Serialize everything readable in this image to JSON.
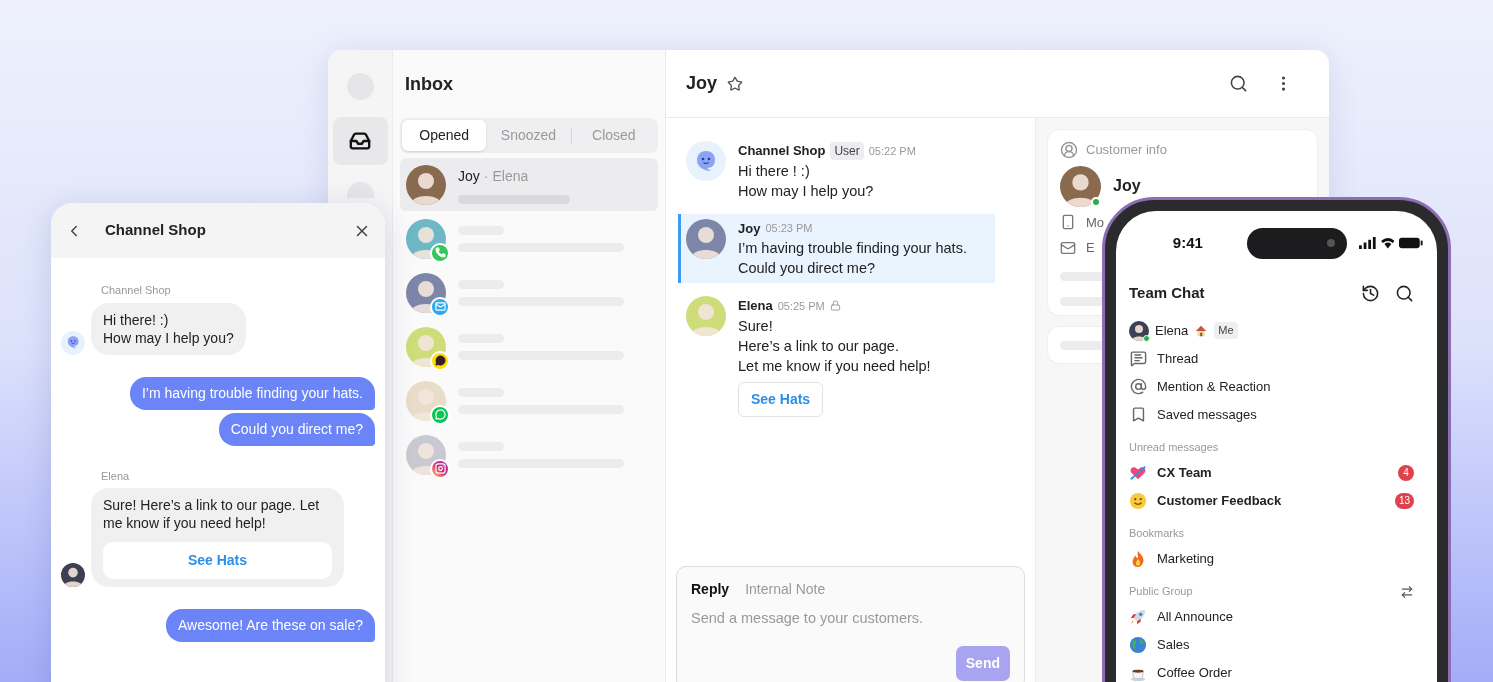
{
  "desktop": {
    "rail": [
      {
        "kind": "placeholder",
        "selected": false
      },
      {
        "kind": "inbox",
        "selected": true
      },
      {
        "kind": "placeholder",
        "selected": false
      }
    ],
    "inbox": {
      "title": "Inbox",
      "tabs": [
        {
          "label": "Opened",
          "selected": true
        },
        {
          "label": "Snoozed",
          "selected": false
        },
        {
          "label": "Closed",
          "selected": false
        }
      ],
      "conversations": [
        {
          "kind": "named",
          "name": "Joy",
          "separator": "·",
          "assignee": "Elena",
          "selected": true
        },
        {
          "kind": "phone",
          "selected": false
        },
        {
          "kind": "email",
          "selected": false
        },
        {
          "kind": "chat",
          "selected": false
        },
        {
          "kind": "line",
          "selected": false
        },
        {
          "kind": "instagram",
          "selected": false
        }
      ]
    },
    "chat": {
      "title": "Joy",
      "messages": [
        {
          "kind": "bot",
          "sender": "Channel Shop",
          "tag": "User",
          "time": "05:22 PM",
          "lines": [
            "Hi there ! :)",
            "How may I help you?"
          ],
          "highlighted": false,
          "locked": false
        },
        {
          "kind": "person",
          "sender": "Joy",
          "time": "05:23 PM",
          "lines": [
            "I’m having trouble finding your hats.",
            "Could you direct me?"
          ],
          "highlighted": true,
          "locked": false
        },
        {
          "kind": "person",
          "sender": "Elena",
          "time": "05:25 PM",
          "lines": [
            "Sure!",
            "Here’s a link to our page.",
            "Let me know if you need help!"
          ],
          "button": "See Hats",
          "highlighted": false,
          "locked": true
        }
      ],
      "composer": {
        "tabs": [
          {
            "label": "Reply",
            "selected": true
          },
          {
            "label": "Internal Note",
            "selected": false
          }
        ],
        "placeholder": "Send a message to your customers.",
        "send": {
          "label": "Send",
          "disabled": true
        }
      }
    },
    "customer": {
      "title": "Customer info",
      "name": "Joy",
      "online": true,
      "fields": [
        {
          "kind": "phone",
          "label": "Mo"
        },
        {
          "kind": "email",
          "label": "E"
        }
      ]
    }
  },
  "widget": {
    "title": "Channel Shop",
    "messages": [
      {
        "kind": "bot",
        "sender": "Channel Shop",
        "lines": [
          "Hi there! :)",
          "How may I help you?"
        ]
      },
      {
        "kind": "outgoing",
        "lines": [
          "I’m having trouble finding your hats."
        ]
      },
      {
        "kind": "outgoing",
        "lines": [
          "Could you direct me?"
        ]
      },
      {
        "kind": "agent",
        "sender": "Elena",
        "lines": [
          "Sure! Here’s a link to our page. Let me know if you need help!"
        ],
        "button": "See Hats"
      },
      {
        "kind": "outgoing",
        "lines": [
          "Awesome! Are these on sale?"
        ]
      }
    ]
  },
  "phone": {
    "time": "9:41",
    "title": "Team Chat",
    "me": {
      "name": "Elena",
      "tag": "Me",
      "online": true
    },
    "items": [
      {
        "kind": "thread",
        "label": "Thread"
      },
      {
        "kind": "mention",
        "label": "Mention & Reaction"
      },
      {
        "kind": "saved",
        "label": "Saved messages"
      }
    ],
    "sections": [
      {
        "title": "Unread messages",
        "swap": false,
        "channels": [
          {
            "kind": "heart",
            "label": "CX Team",
            "unread": true,
            "count": "4"
          },
          {
            "kind": "smile",
            "label": "Customer Feedback",
            "unread": true,
            "count": "13"
          }
        ]
      },
      {
        "title": "Bookmarks",
        "swap": false,
        "channels": [
          {
            "kind": "flame",
            "label": "Marketing",
            "unread": false
          }
        ]
      },
      {
        "title": "Public Group",
        "swap": true,
        "channels": [
          {
            "kind": "rocket",
            "label": "All Announce",
            "unread": false
          },
          {
            "kind": "globe",
            "label": "Sales",
            "unread": false
          },
          {
            "kind": "coffee",
            "label": "Coffee Order",
            "unread": false
          }
        ]
      }
    ]
  }
}
